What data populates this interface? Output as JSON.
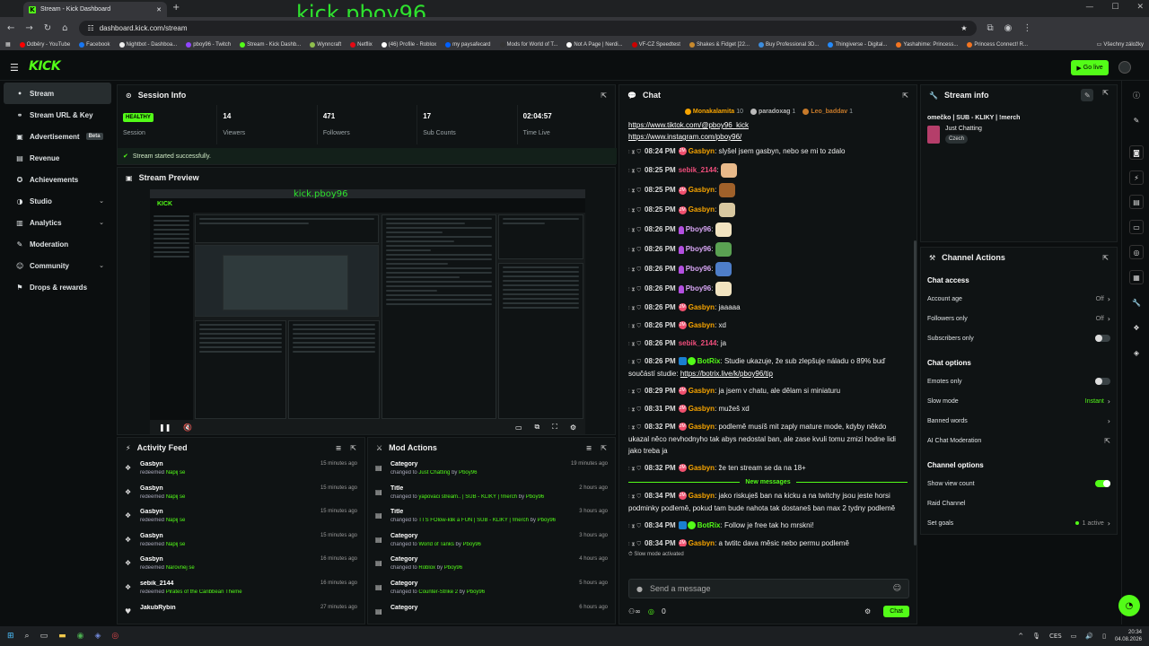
{
  "browser": {
    "tab_title": "Stream - Kick Dashboard",
    "url": "dashboard.kick.com/stream",
    "watermark": "kick.pboy96",
    "bookmarks": [
      {
        "label": "Odběry - YouTube",
        "color": "#ff0000"
      },
      {
        "label": "Facebook",
        "color": "#1877f2"
      },
      {
        "label": "Nightbot - Dashboa...",
        "color": "#eeeeee"
      },
      {
        "label": "pboy96 - Twitch",
        "color": "#9146ff"
      },
      {
        "label": "Stream - Kick Dashb...",
        "color": "#53fc18"
      },
      {
        "label": "Wynncraft",
        "color": "#8fbf4d"
      },
      {
        "label": "Netflix",
        "color": "#e50914"
      },
      {
        "label": "(46) Profile - Roblox",
        "color": "#ffffff"
      },
      {
        "label": "my paysafecard",
        "color": "#0060ff"
      },
      {
        "label": "Mods for World of T...",
        "color": "#333333"
      },
      {
        "label": "Not A Page | Nerdi...",
        "color": "#ffffff"
      },
      {
        "label": "VF-CZ Speedtest",
        "color": "#cc0000"
      },
      {
        "label": "Shakes & Fidget [22...",
        "color": "#c98a2d"
      },
      {
        "label": "Buy Professional 3D...",
        "color": "#3c8dde"
      },
      {
        "label": "Thingiverse - Digital...",
        "color": "#248bfb"
      },
      {
        "label": "Yashahime: Princess...",
        "color": "#f47521"
      },
      {
        "label": "Princess Connect! R...",
        "color": "#f47521"
      }
    ],
    "all_bookmarks": "Všechny záložky"
  },
  "header": {
    "logo": "KICK",
    "go_live": "Go live"
  },
  "sidebar": {
    "items": [
      {
        "label": "Stream",
        "icon": "•",
        "active": true
      },
      {
        "label": "Stream URL & Key",
        "icon": "⚭"
      },
      {
        "label": "Advertisement",
        "icon": "▣",
        "badge": "Beta"
      },
      {
        "label": "Revenue",
        "icon": "▤"
      },
      {
        "label": "Achievements",
        "icon": "✪"
      },
      {
        "label": "Studio",
        "icon": "◑",
        "chevron": true
      },
      {
        "label": "Analytics",
        "icon": "▥",
        "chevron": true
      },
      {
        "label": "Moderation",
        "icon": "✎"
      },
      {
        "label": "Community",
        "icon": "☺",
        "chevron": true
      },
      {
        "label": "Drops & rewards",
        "icon": "⚑"
      }
    ]
  },
  "session": {
    "title": "Session Info",
    "stats": [
      {
        "value": "HEALTHY",
        "label": "Session",
        "badge": true
      },
      {
        "value": "14",
        "label": "Viewers"
      },
      {
        "value": "471",
        "label": "Followers"
      },
      {
        "value": "17",
        "label": "Sub Counts"
      },
      {
        "value": "02:04:57",
        "label": "Time Live"
      }
    ],
    "status": "Stream started successfully."
  },
  "preview": {
    "title": "Stream Preview",
    "overlay": "kick.pboy96"
  },
  "activity": {
    "title": "Activity Feed",
    "rows": [
      {
        "name": "Gasbyn",
        "text": "redeemed",
        "reward": "Napij se",
        "time": "15 minutes ago"
      },
      {
        "name": "Gasbyn",
        "text": "redeemed",
        "reward": "Napij se",
        "time": "15 minutes ago"
      },
      {
        "name": "Gasbyn",
        "text": "redeemed",
        "reward": "Napij se",
        "time": "15 minutes ago"
      },
      {
        "name": "Gasbyn",
        "text": "redeemed",
        "reward": "Napij se",
        "time": "15 minutes ago"
      },
      {
        "name": "Gasbyn",
        "text": "redeemed",
        "reward": "Narovnej se",
        "time": "16 minutes ago"
      },
      {
        "name": "sebik_2144",
        "text": "redeemed",
        "reward": "Pirates of the Caribbean Theme",
        "time": "16 minutes ago"
      },
      {
        "name": "JakubRybin",
        "text": "",
        "reward": "",
        "time": "27 minutes ago"
      }
    ]
  },
  "mod": {
    "title": "Mod Actions",
    "rows": [
      {
        "name": "Category",
        "text": "changed to",
        "target": "Just Chatting",
        "by": "by",
        "user": "Pboy96",
        "time": "19 minutes ago"
      },
      {
        "name": "Title",
        "text": "changed to",
        "target": "yapovaci stream.. | SUB - KLIKY | !merch",
        "by": "by",
        "user": "Pboy96",
        "time": "2 hours ago"
      },
      {
        "name": "Title",
        "text": "changed to",
        "target": "TTS FOlow-klik a FUN | SUB - KLIKY | !merch",
        "by": "by",
        "user": "Pboy96",
        "time": "3 hours ago"
      },
      {
        "name": "Category",
        "text": "changed to",
        "target": "World of Tanks",
        "by": "by",
        "user": "Pboy96",
        "time": "3 hours ago"
      },
      {
        "name": "Category",
        "text": "changed to",
        "target": "Roblox",
        "by": "by",
        "user": "Pboy96",
        "time": "4 hours ago"
      },
      {
        "name": "Category",
        "text": "changed to",
        "target": "Counter-Strike 2",
        "by": "by",
        "user": "Pboy96",
        "time": "5 hours ago"
      },
      {
        "name": "Category",
        "text": "",
        "target": "",
        "by": "",
        "user": "",
        "time": "6 hours ago"
      }
    ]
  },
  "chat": {
    "title": "Chat",
    "gifters": [
      {
        "name": "Monakalamita",
        "count": "10",
        "color": "#f7a400"
      },
      {
        "name": "paradoxag",
        "count": "1",
        "color": "#bbbbbb"
      },
      {
        "name": "Leo_baddav",
        "count": "1",
        "color": "#c77a2a"
      }
    ],
    "links": [
      "https://www.tiktok.com/@pboy96_kick",
      "https://www.instagram.com/pboy96/"
    ],
    "messages": [
      {
        "time": "08:24 PM",
        "user": "Gasbyn",
        "color": "#f7a400",
        "badge": "sub",
        "text": "slyšel jsem gasbyn, nebo se mi to zdalo"
      },
      {
        "time": "08:25 PM",
        "user": "sebik_2144",
        "color": "#f04e7c",
        "badge": "",
        "text": "",
        "emote": "#e8b98a"
      },
      {
        "time": "08:25 PM",
        "user": "Gasbyn",
        "color": "#f7a400",
        "badge": "sub",
        "text": "",
        "emote": "#a0612a"
      },
      {
        "time": "08:25 PM",
        "user": "Gasbyn",
        "color": "#f7a400",
        "badge": "sub",
        "text": "",
        "emote": "#d8c8a0"
      },
      {
        "time": "08:26 PM",
        "user": "Pboy96",
        "color": "#d8a6f5",
        "badge": "pb",
        "text": "",
        "emote": "#f1e3c0"
      },
      {
        "time": "08:26 PM",
        "user": "Pboy96",
        "color": "#d8a6f5",
        "badge": "pb",
        "text": "",
        "emote": "#5aa152"
      },
      {
        "time": "08:26 PM",
        "user": "Pboy96",
        "color": "#d8a6f5",
        "badge": "pb",
        "text": "",
        "emote": "#4e7ec9"
      },
      {
        "time": "08:26 PM",
        "user": "Pboy96",
        "color": "#d8a6f5",
        "badge": "pb",
        "text": "",
        "emote": "#f1e3c0"
      },
      {
        "time": "08:26 PM",
        "user": "Gasbyn",
        "color": "#f7a400",
        "badge": "sub",
        "text": "jaaaaa"
      },
      {
        "time": "08:26 PM",
        "user": "Gasbyn",
        "color": "#f7a400",
        "badge": "sub",
        "text": "xd"
      },
      {
        "time": "08:26 PM",
        "user": "sebik_2144",
        "color": "#f04e7c",
        "badge": "",
        "text": "ja"
      },
      {
        "time": "08:26 PM",
        "user": "BotRix",
        "color": "#53fc18",
        "badge": "bot",
        "text": "Studie ukazuje, že sub zlepšuje náladu o 89% buď součástí studie: ",
        "link": "https://botrix.live/k/pboy96/tip"
      },
      {
        "time": "08:29 PM",
        "user": "Gasbyn",
        "color": "#f7a400",
        "badge": "sub",
        "text": "ja jsem v chatu, ale dělam si miniaturu"
      },
      {
        "time": "08:31 PM",
        "user": "Gasbyn",
        "color": "#f7a400",
        "badge": "sub",
        "text": "mužeš xd"
      },
      {
        "time": "08:32 PM",
        "user": "Gasbyn",
        "color": "#f7a400",
        "badge": "sub",
        "text": "podlemě musíš mit zaply mature mode, kdyby někdo ukazal něco nevhodnyho tak abys nedostal ban, ale zase kvuli tomu zmizi hodne lidi jako treba ja"
      },
      {
        "time": "08:32 PM",
        "user": "Gasbyn",
        "color": "#f7a400",
        "badge": "sub",
        "text": "že ten stream se da na 18+"
      }
    ],
    "new_messages": "New messages",
    "messages2": [
      {
        "time": "08:34 PM",
        "user": "Gasbyn",
        "color": "#f7a400",
        "badge": "sub",
        "text": "jako riskuješ ban na kicku a na twitchy jsou jeste horsi podminky podlemě, pokud tam bude nahota tak dostaneš ban max 2 tydny podlemě"
      },
      {
        "time": "08:34 PM",
        "user": "BotRix",
        "color": "#53fc18",
        "badge": "bot",
        "text": "Follow je free tak ho mrskni!"
      },
      {
        "time": "08:34 PM",
        "user": "Gasbyn",
        "color": "#f7a400",
        "badge": "sub",
        "text": "a twtitc dava měsic nebo permu podlemě"
      }
    ],
    "slow_mode": "Slow mode activated",
    "emote_colors": [
      "#f1e3c0",
      "#4e7ec9",
      "#5aa152",
      "#c77a2a",
      "#3c8dde",
      "#2a7a2a",
      "#d8c8a0",
      "#f04e7c",
      "#e8b98a",
      "#a0612a"
    ],
    "input_placeholder": "Send a message",
    "points": "0",
    "send": "Chat",
    "sub_badge_text": "2M"
  },
  "streaminfo": {
    "title": "Stream info",
    "stream_title": "omečko | SUB - KLIKY | !merch",
    "category": "Just Chatting",
    "tag": "Czech"
  },
  "actions": {
    "title": "Channel Actions",
    "sections": [
      {
        "title": "Chat access",
        "rows": [
          {
            "label": "Account age",
            "value": "Off",
            "kind": "chevron"
          },
          {
            "label": "Followers only",
            "value": "Off",
            "kind": "chevron"
          },
          {
            "label": "Subscribers only",
            "value": "",
            "kind": "toggle",
            "on": false
          }
        ]
      },
      {
        "title": "Chat options",
        "rows": [
          {
            "label": "Emotes only",
            "value": "",
            "kind": "toggle",
            "on": false
          },
          {
            "label": "Slow mode",
            "value": "Instant",
            "kind": "chevron",
            "green": true
          },
          {
            "label": "Banned words",
            "value": "",
            "kind": "chevron"
          },
          {
            "label": "AI Chat Moderation",
            "value": "",
            "kind": "external"
          }
        ]
      },
      {
        "title": "Channel options",
        "rows": [
          {
            "label": "Show view count",
            "value": "",
            "kind": "toggle",
            "on": true
          },
          {
            "label": "Raid Channel",
            "value": "",
            "kind": "none"
          },
          {
            "label": "Set goals",
            "value": "1 active",
            "kind": "chevron",
            "dot": true
          }
        ]
      }
    ]
  },
  "taskbar": {
    "lang": "CES",
    "time": "20:34",
    "date": "04.08.2026"
  }
}
